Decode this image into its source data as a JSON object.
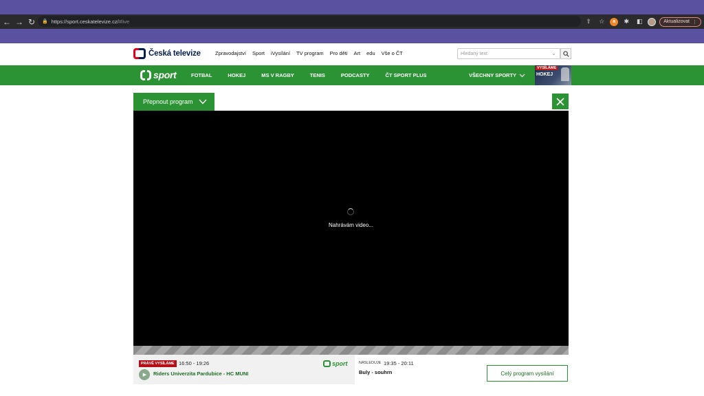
{
  "browser": {
    "url_host": "https://sport.ceskatelevize.cz/",
    "url_path": "#live",
    "update_label": "Aktualizovat",
    "extension_letter": "a"
  },
  "header": {
    "logo_text": "Česká televize",
    "nav": [
      "Zpravodajství",
      "Sport",
      "iVysílání",
      "TV program",
      "Pro děti",
      "Art",
      "edu",
      "Vše o ČT"
    ],
    "search_placeholder": "Hledaný text"
  },
  "sport_nav": {
    "logo_text": "sport",
    "items": [
      "FOTBAL",
      "HOKEJ",
      "MS V RAGBY",
      "TENIS",
      "PODCASTY",
      "ČT SPORT PLUS"
    ],
    "all_sports": "VŠECHNY SPORTY",
    "live_tag": "VYSÍLÁME",
    "live_sport": "HOKEJ"
  },
  "player": {
    "switch_label": "Přepnout program",
    "loading_text": "Nahrávám video..."
  },
  "now": {
    "badge": "PRÁVĚ VYSÍLÁME",
    "time": "16:50 - 19:26",
    "channel": "sport",
    "title": "Riders Univerzita Pardubice - HC MUNI"
  },
  "next": {
    "label": "NÁSLEDUJE",
    "time": "19:35 - 20:11",
    "title": "Buly - souhrn"
  },
  "full_program_label": "Celý program vysílání",
  "colors": {
    "brand_green": "#2c9335",
    "brand_red": "#e0001b",
    "brand_navy": "#041e50",
    "browser_accent": "#5a52a0"
  }
}
